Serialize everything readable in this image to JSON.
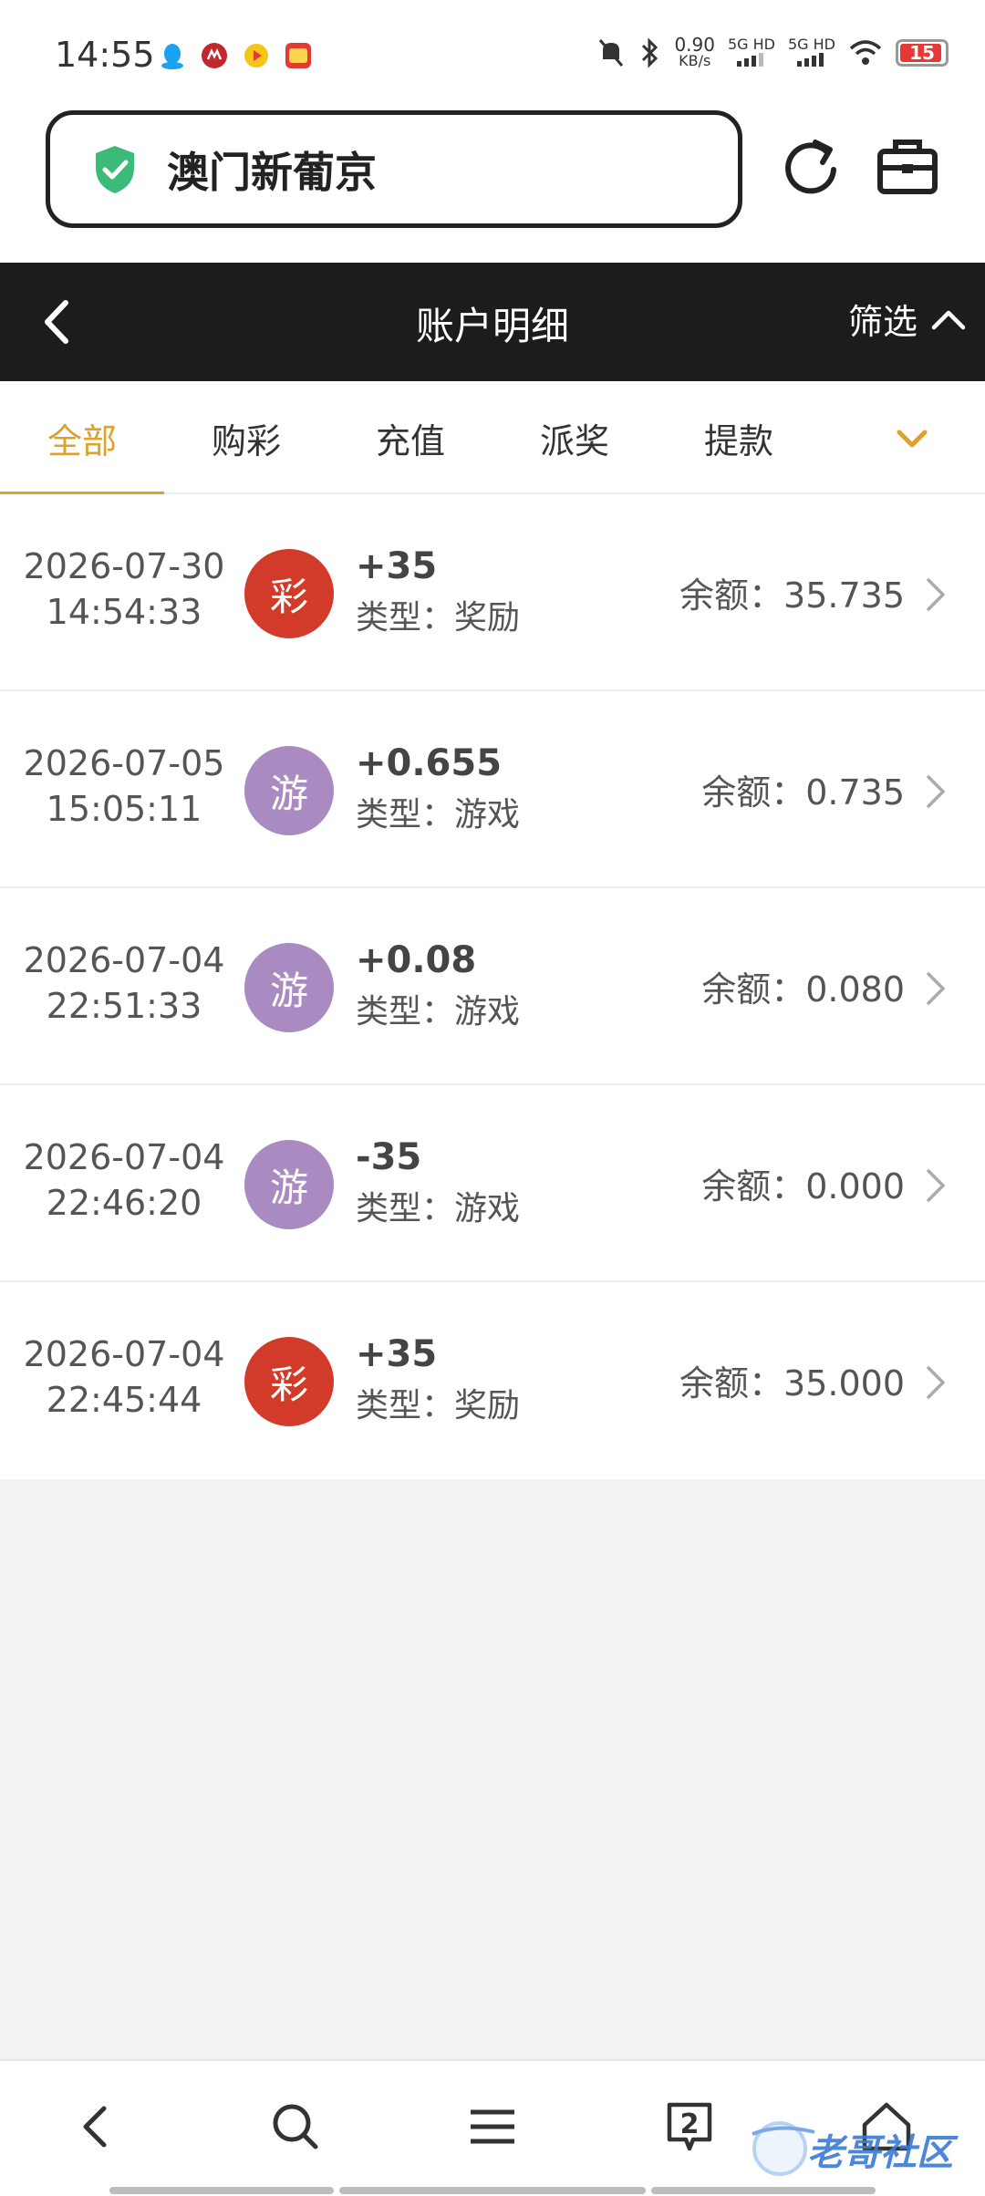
{
  "status_bar": {
    "time": "14:55",
    "net_speed_value": "0.90",
    "net_speed_unit": "KB/s",
    "signal1_label": "5G HD",
    "signal2_label": "5G HD",
    "battery_level": "15"
  },
  "browser": {
    "url_text": "澳门新葡京",
    "shield_color": "#3cba7a"
  },
  "header": {
    "title": "账户明细",
    "filter_label": "筛选"
  },
  "tabs": [
    {
      "label": "全部",
      "active": true
    },
    {
      "label": "购彩",
      "active": false
    },
    {
      "label": "充值",
      "active": false
    },
    {
      "label": "派奖",
      "active": false
    },
    {
      "label": "提款",
      "active": false
    }
  ],
  "records": [
    {
      "date": "2026-07-30",
      "time": "14:54:33",
      "badge": "彩",
      "badge_color": "#d23a2a",
      "amount": "+35",
      "type": "类型：奖励",
      "balance": "余额：35.735"
    },
    {
      "date": "2026-07-05",
      "time": "15:05:11",
      "badge": "游",
      "badge_color": "#a98bc2",
      "amount": "+0.655",
      "type": "类型：游戏",
      "balance": "余额：0.735"
    },
    {
      "date": "2026-07-04",
      "time": "22:51:33",
      "badge": "游",
      "badge_color": "#a98bc2",
      "amount": "+0.08",
      "type": "类型：游戏",
      "balance": "余额：0.080"
    },
    {
      "date": "2026-07-04",
      "time": "22:46:20",
      "badge": "游",
      "badge_color": "#a98bc2",
      "amount": "-35",
      "type": "类型：游戏",
      "balance": "余额：0.000"
    },
    {
      "date": "2026-07-04",
      "time": "22:45:44",
      "badge": "彩",
      "badge_color": "#d23a2a",
      "amount": "+35",
      "type": "类型：奖励",
      "balance": "余额：35.000"
    }
  ],
  "bottom_nav": {
    "tab_count": "2",
    "watermark_text": "老哥社区"
  },
  "colors": {
    "accent": "#e0a12b",
    "header_bg": "#1c1c1c"
  }
}
